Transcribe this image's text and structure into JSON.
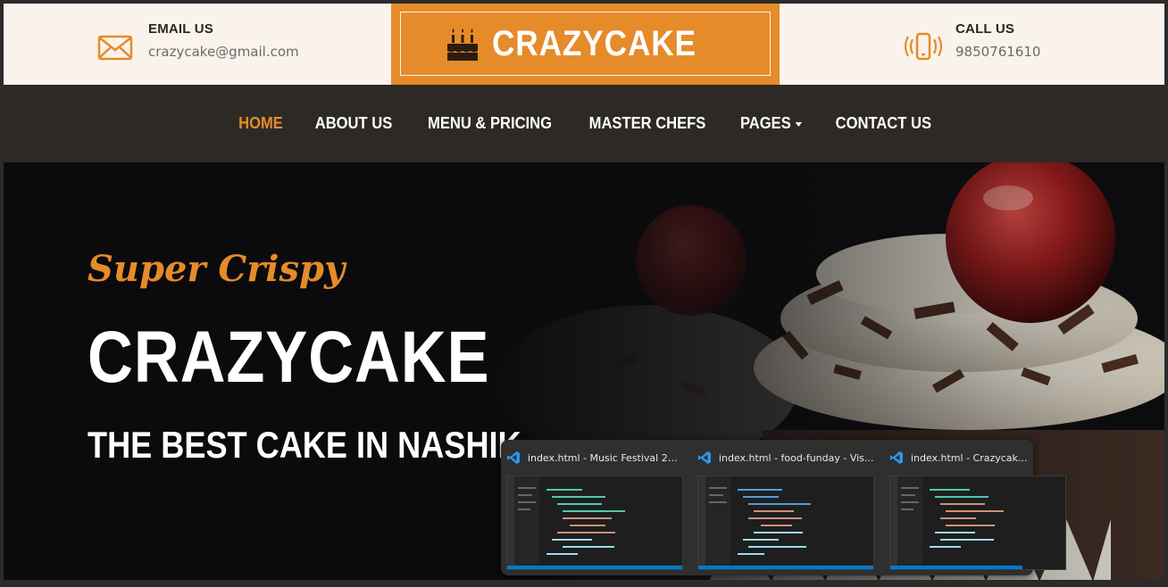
{
  "header": {
    "email": {
      "label": "EMAIL US",
      "value": "crazycake@gmail.com",
      "icon": "envelope-icon"
    },
    "brand": {
      "name": "CRAZYCAKE",
      "icon": "birthday-cake-icon"
    },
    "call": {
      "label": "CALL US",
      "value": "9850761610",
      "icon": "phone-vibrate-icon"
    }
  },
  "nav": {
    "items": [
      {
        "label": "HOME",
        "active": true
      },
      {
        "label": "ABOUT US"
      },
      {
        "label": "MENU & PRICING"
      },
      {
        "label": "MASTER CHEFS"
      },
      {
        "label": "PAGES",
        "dropdown": true
      },
      {
        "label": "CONTACT US"
      }
    ]
  },
  "hero": {
    "tagline": "Super Crispy",
    "title": "CRAZYCAKE",
    "subtitle": "THE BEST CAKE IN NASHIK"
  },
  "taskbar_preview": {
    "windows": [
      {
        "title": "index.html - Music Festival 202...",
        "icon": "vscode-icon"
      },
      {
        "title": "index.html - food-funday - Vis...",
        "icon": "vscode-icon"
      },
      {
        "title": "index.html - Crazycak...",
        "icon": "vscode-icon"
      }
    ]
  },
  "colors": {
    "accent": "#e58b2a",
    "nav_bg": "#2d2a26",
    "topbar_bg": "#faf3eb"
  }
}
